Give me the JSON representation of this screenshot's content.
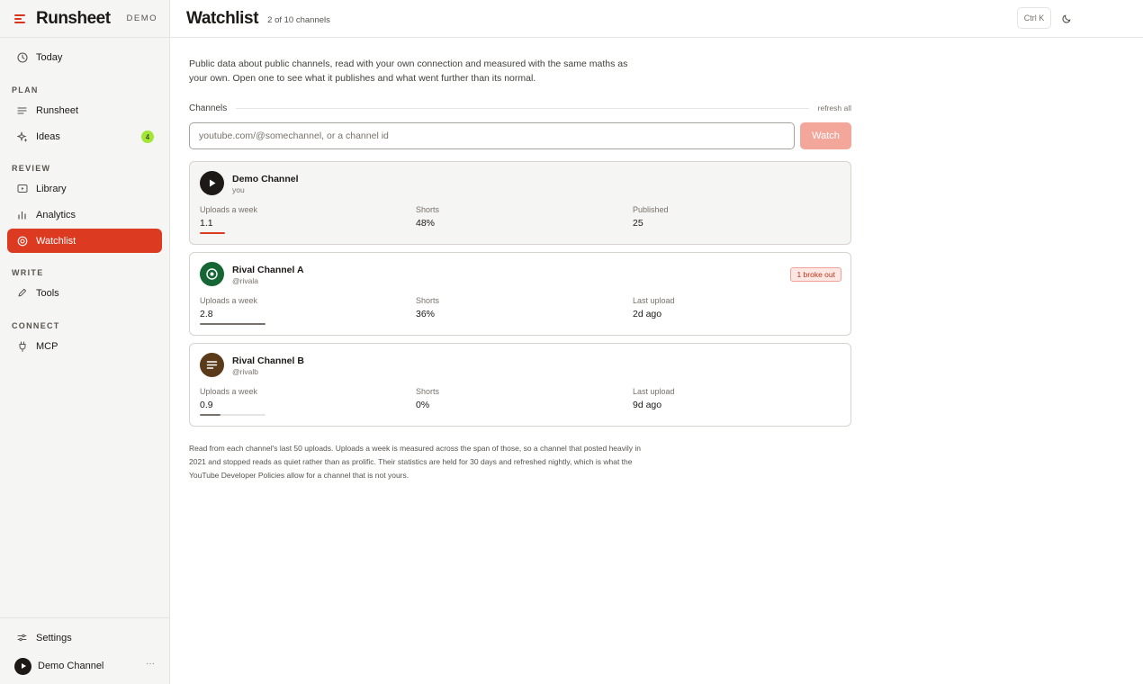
{
  "app": {
    "name": "Runsheet",
    "mode_badge": "DEMO"
  },
  "colors": {
    "accent": "#dc3b22",
    "badge_green": "#a3e635"
  },
  "sidebar": {
    "today": {
      "label": "Today",
      "icon": "clock-icon"
    },
    "sections": {
      "plan": "PLAN",
      "review": "REVIEW",
      "write": "WRITE",
      "connect": "CONNECT"
    },
    "items": {
      "runsheet": {
        "label": "Runsheet",
        "icon": "lines-icon"
      },
      "ideas": {
        "label": "Ideas",
        "icon": "sparkle-icon",
        "badge": "4"
      },
      "library": {
        "label": "Library",
        "icon": "video-box-icon"
      },
      "analytics": {
        "label": "Analytics",
        "icon": "bar-chart-icon"
      },
      "watchlist": {
        "label": "Watchlist",
        "icon": "target-icon",
        "active": true
      },
      "tools": {
        "label": "Tools",
        "icon": "pencil-icon"
      },
      "mcp": {
        "label": "MCP",
        "icon": "plug-icon"
      }
    },
    "settings": {
      "label": "Settings",
      "icon": "sliders-icon"
    },
    "user": {
      "name": "Demo Channel",
      "more": "···"
    }
  },
  "header": {
    "title": "Watchlist",
    "subtitle": "2 of 10 channels",
    "shortcut": "Ctrl K",
    "theme_icon": "moon-icon"
  },
  "main": {
    "intro": "Public data about public channels, read with your own connection and measured with the same maths as your own. Open one to see what it publishes and what went further than its normal.",
    "channels_label": "Channels",
    "refresh_label": "refresh all",
    "search_placeholder": "youtube.com/@somechannel, or a channel id",
    "search_value": "",
    "watch_label": "Watch",
    "channels": [
      {
        "name": "Demo Channel",
        "handle": "you",
        "avatar_icon": "play-icon",
        "stats": [
          {
            "label": "Uploads a week",
            "value": "1.1"
          },
          {
            "label": "Shorts",
            "value": "48%"
          },
          {
            "label": "Published",
            "value": "25"
          }
        ],
        "badge": "",
        "bar_fraction": 0.38,
        "bar_color": "#dc3b22"
      },
      {
        "name": "Rival Channel A",
        "handle": "@rivala",
        "avatar_icon": "target-icon",
        "stats": [
          {
            "label": "Uploads a week",
            "value": "2.8"
          },
          {
            "label": "Shorts",
            "value": "36%"
          },
          {
            "label": "Last upload",
            "value": "2d ago"
          }
        ],
        "badge": "1 broke out",
        "bar_fraction": 1.0,
        "bar_color": "#78716c"
      },
      {
        "name": "Rival Channel B",
        "handle": "@rivalb",
        "avatar_icon": "lines-icon",
        "stats": [
          {
            "label": "Uploads a week",
            "value": "0.9"
          },
          {
            "label": "Shorts",
            "value": "0%"
          },
          {
            "label": "Last upload",
            "value": "9d ago"
          }
        ],
        "badge": "",
        "bar_fraction": 0.32,
        "bar_color": "#78716c"
      }
    ],
    "footnote": "Read from each channel's last 50 uploads. Uploads a week is measured across the span of those, so a channel that posted heavily in 2021 and stopped reads as quiet rather than as prolific. Their statistics are held for 30 days and refreshed nightly, which is what the YouTube Developer Policies allow for a channel that is not yours."
  }
}
